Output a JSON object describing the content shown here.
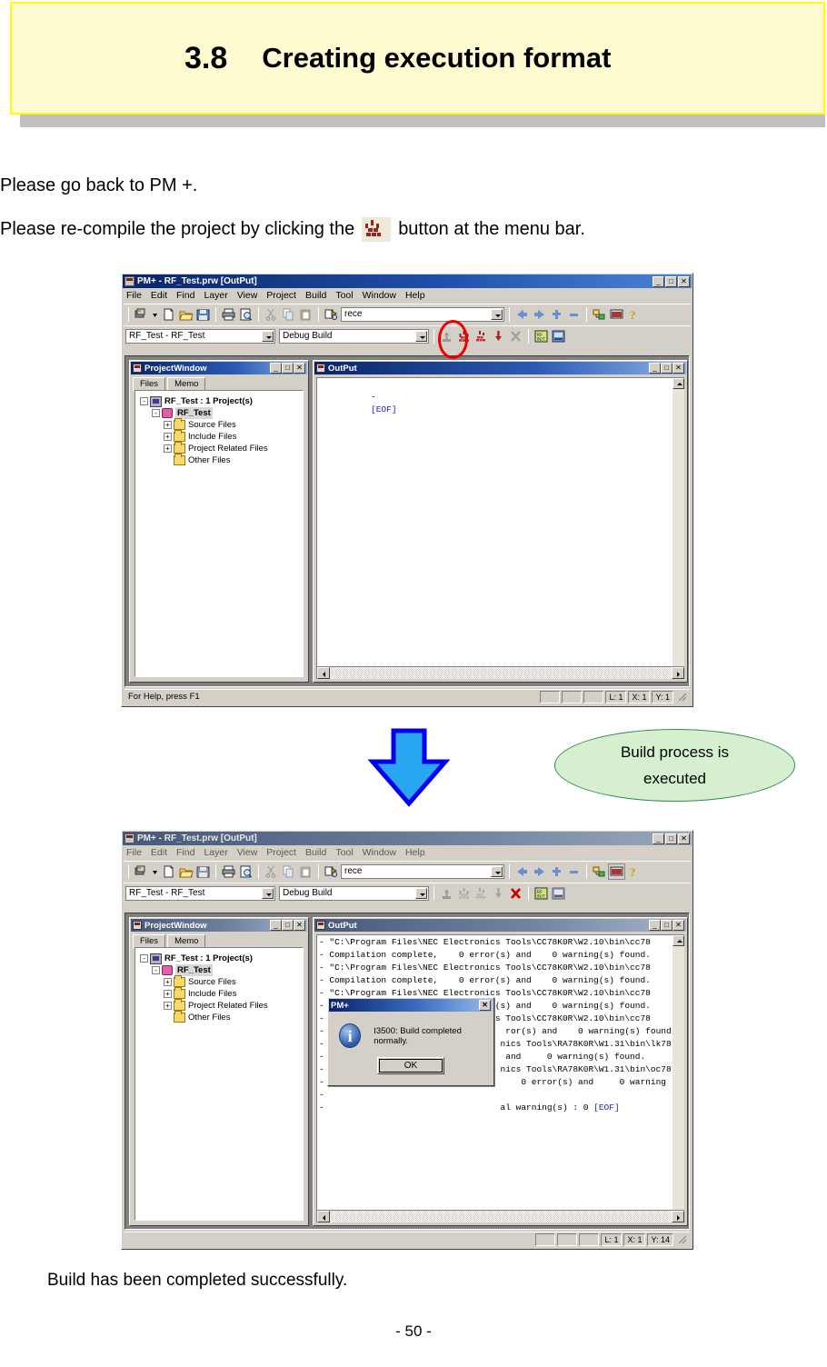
{
  "header": {
    "section_number": "3.8",
    "section_title": "Creating execution format"
  },
  "body": {
    "line1": "Please go back to PM +.",
    "line2_before": "Please re-compile the project by clicking the",
    "line2_after": "button at the menu bar.",
    "inline_icon": "build-icon",
    "footer": "Build has been completed successfully.",
    "page_number": "- 50 -"
  },
  "callout": {
    "line1": "Build process is",
    "line2": "executed",
    "fill_color": "#d6f0cf",
    "border_color": "#2e8b57",
    "arrow_fill": "#29a6f2",
    "arrow_stroke": "#0000ee"
  },
  "highlight": {
    "ring_color": "#ee0000"
  },
  "window_before": {
    "title": "PM+ - RF_Test.prw [OutPut]",
    "title_icon": "pm-plus-icon",
    "window_buttons": [
      "_",
      "□",
      "✕"
    ],
    "menu": [
      "File",
      "Edit",
      "Find",
      "Layer",
      "View",
      "Project",
      "Build",
      "Tool",
      "Window",
      "Help"
    ],
    "toolbar_icons": [
      "workspace-icon",
      "dropdown-arrow-icon",
      "new-file-icon",
      "open-folder-icon",
      "save-icon",
      "print-icon",
      "print-preview-icon",
      "cut-icon",
      "copy-icon",
      "paste-icon",
      "find-icon"
    ],
    "find_combo_value": "rece",
    "nav_icons": [
      "arrow-left-icon",
      "arrow-right-icon",
      "bookmark-add-icon",
      "bookmark-remove-icon"
    ],
    "right_icons": [
      "project-window-icon",
      "output-window-icon",
      "help-icon"
    ],
    "project_combo_value": "RF_Test - RF_Test",
    "build_mode_combo_value": "Debug Build",
    "build_icons": [
      "compile-icon",
      "build-icon",
      "rebuild-icon",
      "build-download-icon",
      "stop-build-icon",
      "rf-editor-icon",
      "device-icon"
    ],
    "project_window": {
      "title": "ProjectWindow",
      "title_icon": "project-window-icon",
      "window_buttons": [
        "_",
        "□",
        "✕"
      ],
      "tabs": [
        {
          "label": "Files",
          "active": true
        },
        {
          "label": "Memo",
          "active": false
        }
      ],
      "tree": [
        {
          "label": "RF_Test : 1 Project(s)",
          "indent": 0,
          "expander": "-",
          "icon": "project-root-icon",
          "bold": true,
          "selected": false
        },
        {
          "label": "RF_Test",
          "indent": 1,
          "expander": "-",
          "icon": "project-icon",
          "bold": true,
          "selected": true
        },
        {
          "label": "Source Files",
          "indent": 2,
          "expander": "+",
          "icon": "folder-icon",
          "bold": false,
          "selected": false
        },
        {
          "label": "Include Files",
          "indent": 2,
          "expander": "+",
          "icon": "folder-icon",
          "bold": false,
          "selected": false
        },
        {
          "label": "Project Related Files",
          "indent": 2,
          "expander": "+",
          "icon": "folder-icon",
          "bold": false,
          "selected": false
        },
        {
          "label": "Other Files",
          "indent": 2,
          "expander": "",
          "icon": "folder-icon",
          "bold": false,
          "selected": false
        }
      ]
    },
    "output_window": {
      "title": "OutPut",
      "title_icon": "output-window-icon",
      "window_buttons": [
        "_",
        "□",
        "✕"
      ],
      "lines": [
        {
          "prefix": "-",
          "text": "[EOF]",
          "eof": true
        }
      ]
    },
    "statusbar": {
      "hint": "For Help, press F1",
      "panes": [
        "",
        "",
        "",
        "L: 1",
        "X: 1",
        "Y: 1"
      ]
    }
  },
  "window_after": {
    "title": "PM+ - RF_Test.prw [OutPut]",
    "title_icon": "pm-plus-icon",
    "window_buttons": [
      "_",
      "□",
      "✕"
    ],
    "menu": [
      "File",
      "Edit",
      "Find",
      "Layer",
      "View",
      "Project",
      "Build",
      "Tool",
      "Window",
      "Help"
    ],
    "find_combo_value": "rece",
    "project_combo_value": "RF_Test - RF_Test",
    "build_mode_combo_value": "Debug Build",
    "build_icons": [
      "compile-icon",
      "build-icon",
      "rebuild-icon",
      "build-download-icon",
      "stop-build-icon",
      "rf-editor-icon",
      "device-icon"
    ],
    "project_window": {
      "title": "ProjectWindow",
      "title_icon": "project-window-icon",
      "window_buttons": [
        "_",
        "□",
        "✕"
      ],
      "tabs": [
        {
          "label": "Files",
          "active": true
        },
        {
          "label": "Memo",
          "active": false
        }
      ],
      "tree": [
        {
          "label": "RF_Test : 1 Project(s)",
          "indent": 0,
          "expander": "-",
          "icon": "project-root-icon",
          "bold": true,
          "selected": false
        },
        {
          "label": "RF_Test",
          "indent": 1,
          "expander": "-",
          "icon": "project-icon",
          "bold": true,
          "selected": true
        },
        {
          "label": "Source Files",
          "indent": 2,
          "expander": "+",
          "icon": "folder-icon",
          "bold": false,
          "selected": false
        },
        {
          "label": "Include Files",
          "indent": 2,
          "expander": "+",
          "icon": "folder-icon",
          "bold": false,
          "selected": false
        },
        {
          "label": "Project Related Files",
          "indent": 2,
          "expander": "+",
          "icon": "folder-icon",
          "bold": false,
          "selected": false
        },
        {
          "label": "Other Files",
          "indent": 2,
          "expander": "",
          "icon": "folder-icon",
          "bold": false,
          "selected": false
        }
      ]
    },
    "output_window": {
      "title": "OutPut",
      "title_icon": "output-window-icon",
      "window_buttons": [
        "_",
        "□",
        "✕"
      ],
      "lines": [
        {
          "prefix": "-",
          "text": "\"C:\\Program Files\\NEC Electronics Tools\\CC78K0R\\W2.10\\bin\\cc78",
          "eof": false
        },
        {
          "prefix": "-",
          "text": "Compilation complete,    0 error(s) and    0 warning(s) found.",
          "eof": false
        },
        {
          "prefix": "-",
          "text": "\"C:\\Program Files\\NEC Electronics Tools\\CC78K0R\\W2.10\\bin\\cc78",
          "eof": false
        },
        {
          "prefix": "-",
          "text": "Compilation complete,    0 error(s) and    0 warning(s) found.",
          "eof": false
        },
        {
          "prefix": "-",
          "text": "\"C:\\Program Files\\NEC Electronics Tools\\CC78K0R\\W2.10\\bin\\cc78",
          "eof": false
        },
        {
          "prefix": "-",
          "text": "Compilation complete,    0 error(s) and    0 warning(s) found.",
          "eof": false
        },
        {
          "prefix": "-",
          "text": "\"C:\\Program Files\\NEC Electronics Tools\\CC78K0R\\W2.10\\bin\\cc78",
          "eof": false
        },
        {
          "prefix": "-",
          "text": "                                  ror(s) and    0 warning(s) found.",
          "eof": false
        },
        {
          "prefix": "-",
          "text": "                                 nics Tools\\RA78K0R\\W1.31\\bin\\lk78",
          "eof": false
        },
        {
          "prefix": "-",
          "text": "                                  and     0 warning(s) found.",
          "eof": false
        },
        {
          "prefix": "-",
          "text": "                                 nics Tools\\RA78K0R\\W1.31\\bin\\oc78",
          "eof": false
        },
        {
          "prefix": "-",
          "text": "                                     0 error(s) and     0 warning",
          "eof": false
        },
        {
          "prefix": "-",
          "text": "",
          "eof": false
        },
        {
          "prefix": "-",
          "text": "                                 al warning(s) : 0 ",
          "eof": true,
          "eof_text": "[EOF]"
        }
      ]
    },
    "dialog": {
      "title": "PM+",
      "close_label": "✕",
      "icon": "info-icon",
      "message": "I3500: Build completed normally.",
      "ok_label": "OK"
    },
    "statusbar": {
      "hint": "",
      "panes": [
        "",
        "",
        "",
        "L: 1",
        "X: 1",
        "Y: 14"
      ]
    }
  }
}
